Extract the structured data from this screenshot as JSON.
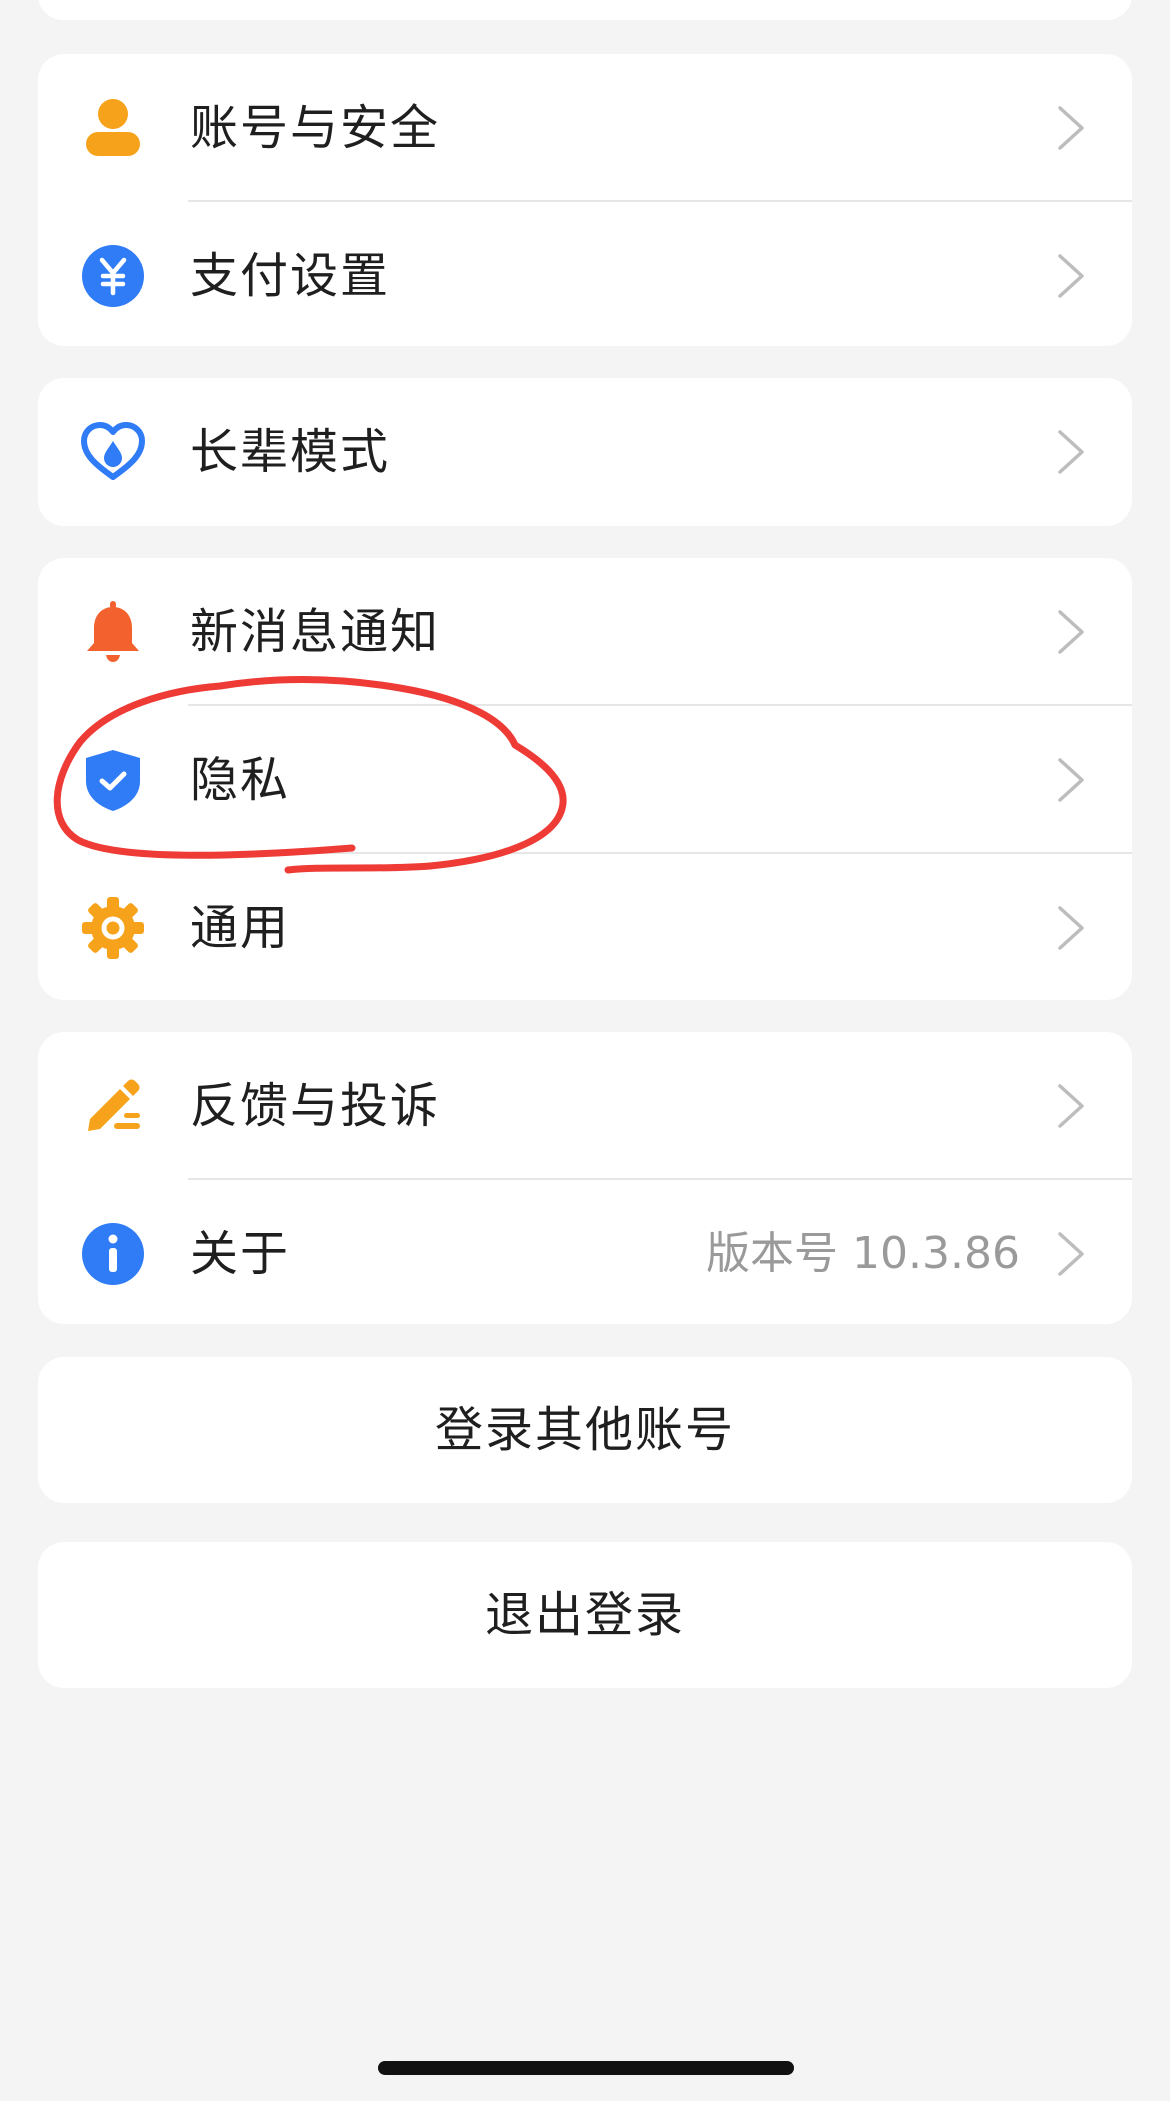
{
  "groups": [
    {
      "items": [
        {
          "label": "账号与安全",
          "icon": "user-icon"
        },
        {
          "label": "支付设置",
          "icon": "yuan-icon"
        }
      ]
    },
    {
      "items": [
        {
          "label": "长辈模式",
          "icon": "heart-hands-icon"
        }
      ]
    },
    {
      "items": [
        {
          "label": "新消息通知",
          "icon": "bell-icon"
        },
        {
          "label": "隐私",
          "icon": "shield-check-icon"
        },
        {
          "label": "通用",
          "icon": "gear-icon"
        }
      ]
    },
    {
      "items": [
        {
          "label": "反馈与投诉",
          "icon": "pencil-icon"
        },
        {
          "label": "关于",
          "icon": "info-icon",
          "value": "版本号 10.3.86"
        }
      ]
    }
  ],
  "actions": {
    "login_other": "登录其他账号",
    "logout": "退出登录"
  },
  "colors": {
    "background": "#f4f4f4",
    "card": "#ffffff",
    "orange": "#f7a21b",
    "blue": "#2f7cf6",
    "red_orange": "#f3622e",
    "annotation_red": "#ee3b36",
    "chevron": "#bdbdbd",
    "secondary_text": "#9a9a9a"
  }
}
